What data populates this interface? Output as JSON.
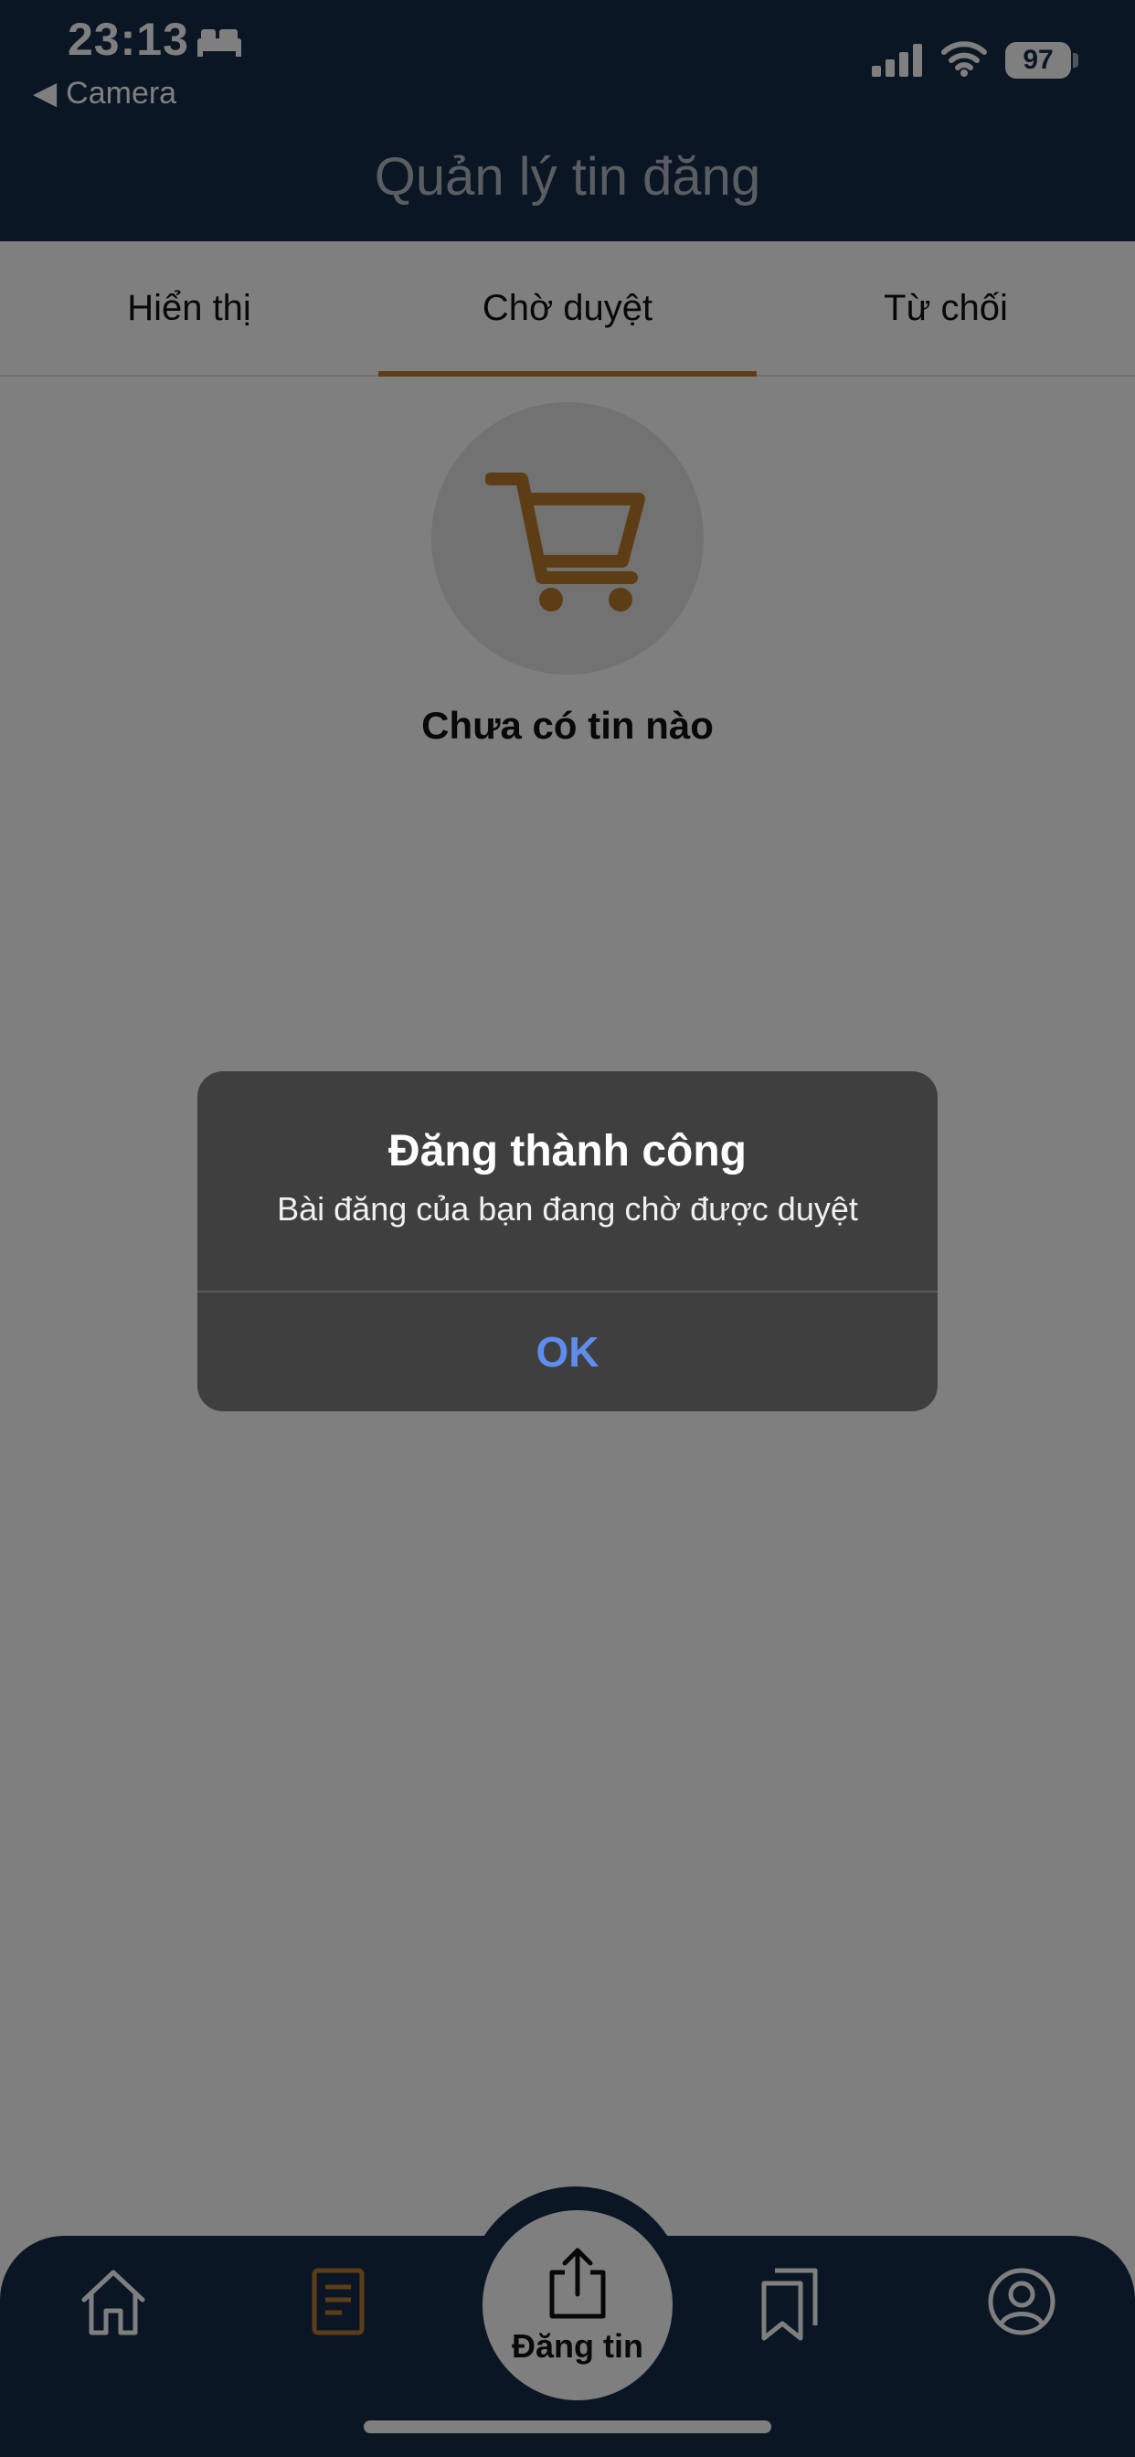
{
  "status_bar": {
    "time": "23:13",
    "back_label": "Camera",
    "battery": "97"
  },
  "header": {
    "title": "Quản lý tin đăng"
  },
  "tabs": [
    {
      "label": "Hiển thị",
      "active": false
    },
    {
      "label": "Chờ duyệt",
      "active": true
    },
    {
      "label": "Từ chối",
      "active": false
    }
  ],
  "empty_state": {
    "icon": "cart-icon",
    "text": "Chưa có tin nào"
  },
  "dialog": {
    "title": "Đăng thành công",
    "message": "Bài đăng của bạn đang chờ được duyệt",
    "ok_label": "OK"
  },
  "bottom_nav": {
    "items": [
      {
        "icon": "home-icon"
      },
      {
        "icon": "document-icon"
      },
      {
        "icon": "share-icon",
        "label": "Đăng tin"
      },
      {
        "icon": "bookmarks-icon"
      },
      {
        "icon": "profile-icon"
      }
    ]
  },
  "colors": {
    "header_bg": "#172c4b",
    "accent": "#b97a2c",
    "ok_blue": "#5e8dee"
  }
}
